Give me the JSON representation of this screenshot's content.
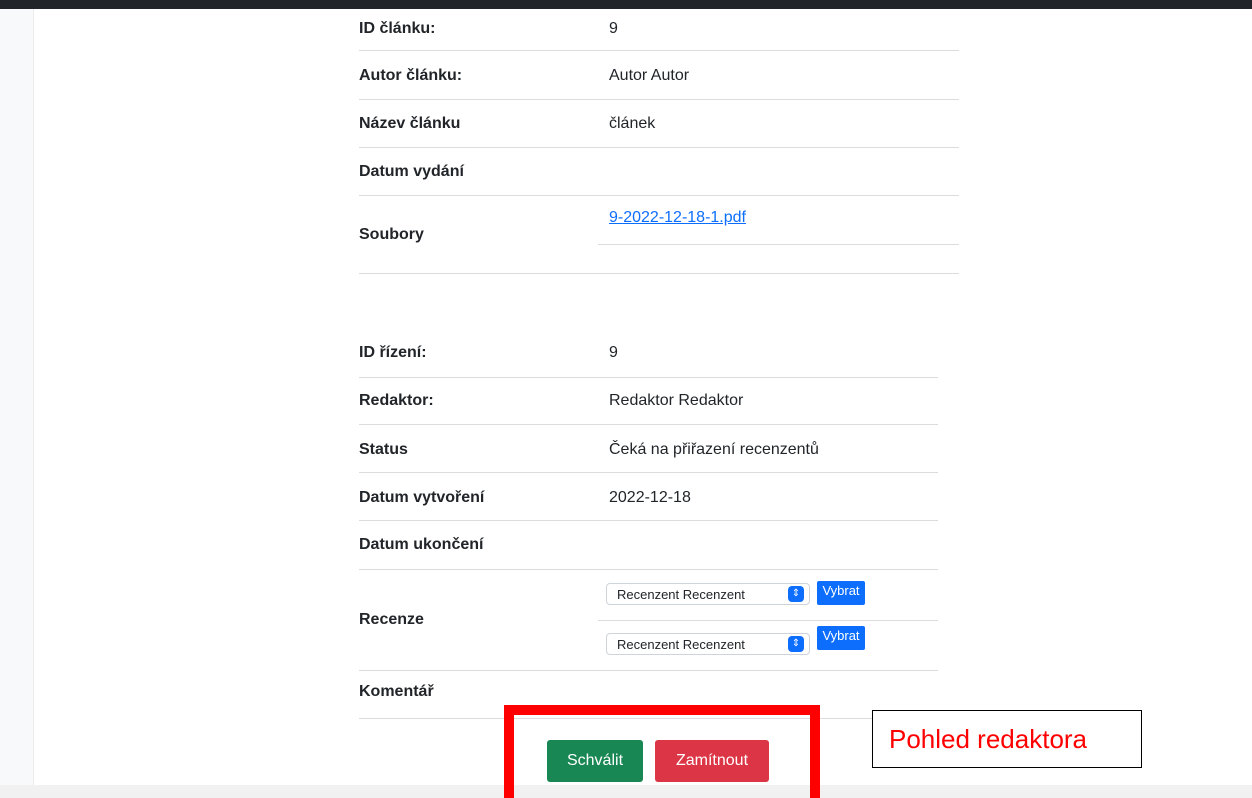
{
  "article": {
    "rows": [
      {
        "label": "ID článku:",
        "value": "9"
      },
      {
        "label": "Autor článku:",
        "value": "Autor Autor"
      },
      {
        "label": "Název článku",
        "value": "článek"
      },
      {
        "label": "Datum vydání",
        "value": ""
      },
      {
        "label": "Soubory",
        "file": "9-2022-12-18-1.pdf"
      }
    ]
  },
  "process": {
    "rows": [
      {
        "label": "ID řízení:",
        "value": "9"
      },
      {
        "label": "Redaktor:",
        "value": "Redaktor Redaktor"
      },
      {
        "label": "Status",
        "value": "Čeká na přiřazení recenzentů"
      },
      {
        "label": "Datum vytvoření",
        "value": "2022-12-18"
      },
      {
        "label": "Datum ukončení",
        "value": ""
      },
      {
        "label": "Recenze",
        "reviewers": [
          {
            "selected": "Recenzent Recenzent",
            "button": "Vybrat"
          },
          {
            "selected": "Recenzent Recenzent",
            "button": "Vybrat"
          }
        ]
      },
      {
        "label": "Komentář",
        "value": ""
      }
    ]
  },
  "actions": {
    "approve": "Schválit",
    "reject": "Zamítnout"
  },
  "annotation": {
    "note": "Pohled redaktora"
  },
  "colors": {
    "link": "#0d6efd",
    "success": "#198754",
    "danger": "#dc3545",
    "highlight": "#ff0000"
  }
}
